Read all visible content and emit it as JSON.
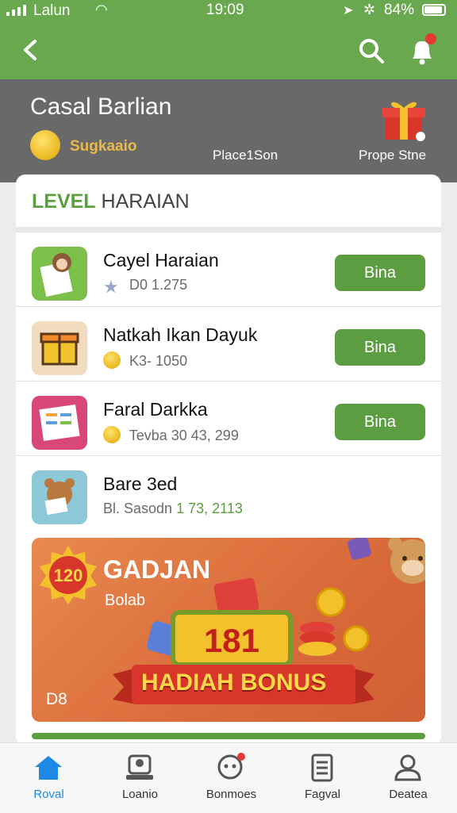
{
  "status": {
    "carrier": "Lalun",
    "time": "19:09",
    "battery": "84%"
  },
  "header": {
    "title": "Casal Barlian",
    "coins": "Sugkaaio",
    "middle_label": "Place1Son",
    "right_label": "Prope Stne"
  },
  "section_title": {
    "green": "LEVEL",
    "dark": "HARAIAN"
  },
  "items": [
    {
      "name": "Cayel Haraian",
      "meta_a": "D0",
      "meta_b": "1.275",
      "button": "Bina"
    },
    {
      "name": "Natkah Ikan Dayuk",
      "meta_a": "K3-",
      "meta_b": "1050",
      "button": "Bina"
    },
    {
      "name": "Faral Darkka",
      "meta_a": "Tevba",
      "meta_b": "30 43, 299",
      "button": "Bina"
    },
    {
      "name": "Bare 3ed",
      "meta_a": "Bl. Sasodn",
      "meta_b": "1",
      "meta_c": "73, 2113"
    }
  ],
  "banner": {
    "seal_number": "120",
    "title": "GADJAN",
    "subtitle": "Bolab",
    "big_number": "181",
    "ribbon": "HADIAH BONUS",
    "corner": "D8"
  },
  "tabs": [
    {
      "label": "Roval",
      "icon": "home-icon",
      "active": true
    },
    {
      "label": "Loanio",
      "icon": "contacts-icon",
      "active": false
    },
    {
      "label": "Bonmoes",
      "icon": "chat-icon",
      "active": false
    },
    {
      "label": "Fagval",
      "icon": "document-icon",
      "active": false
    },
    {
      "label": "Deatea",
      "icon": "profile-icon",
      "active": false
    }
  ],
  "colors": {
    "green": "#6aa84f",
    "button_green": "#5d9d42",
    "header_gray": "#696969",
    "active_tab": "#1e88e5"
  }
}
